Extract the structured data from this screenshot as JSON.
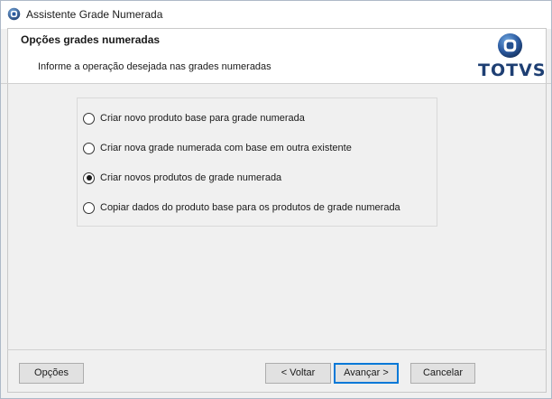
{
  "window": {
    "title": "Assistente Grade Numerada"
  },
  "header": {
    "title": "Opções grades numeradas",
    "description": "Informe a operação desejada nas grades numeradas",
    "logo_text": "TOTVS"
  },
  "options": [
    {
      "label": "Criar novo produto base para grade numerada",
      "checked": false
    },
    {
      "label": "Criar nova grade numerada com base em outra existente",
      "checked": false
    },
    {
      "label": "Criar novos produtos de grade numerada",
      "checked": true
    },
    {
      "label": "Copiar dados do produto base para os produtos de grade numerada",
      "checked": false
    }
  ],
  "buttons": {
    "options_label": "Opções",
    "back_label": "< Voltar",
    "next_label": "Avançar >",
    "cancel_label": "Cancelar"
  },
  "colors": {
    "logo_blue": "#1e3f73",
    "default_button_border": "#0078d7"
  },
  "icons": {
    "title_icon": "app-globe-icon",
    "logo_icon": "totvs-logo-icon"
  }
}
